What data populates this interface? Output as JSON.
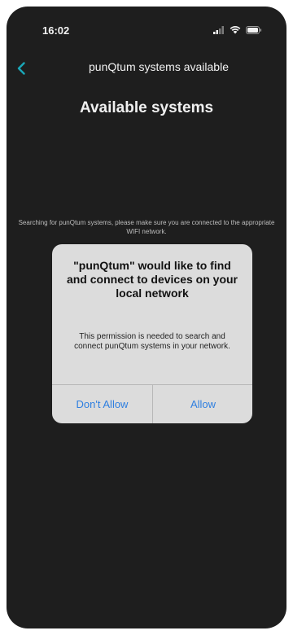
{
  "status_bar": {
    "time": "16:02",
    "icons": [
      "signal-icon",
      "wifi-icon",
      "battery-icon"
    ]
  },
  "nav": {
    "back_icon": "chevron-left-icon",
    "title": "punQtum systems available"
  },
  "page": {
    "title": "Available systems",
    "searching_message": "Searching for punQtum systems, please make sure you are connected to the appropriate WIFI network."
  },
  "alert": {
    "title": "\"punQtum\" would like to find and connect to devices on your local network",
    "message": "This permission is needed to search and connect punQtum systems in your network.",
    "deny_label": "Don't Allow",
    "allow_label": "Allow"
  },
  "colors": {
    "background": "#1e1e1e",
    "accent": "#1aa7b8",
    "alert_bg": "#dcdcdc",
    "alert_button": "#2f7fe0"
  }
}
